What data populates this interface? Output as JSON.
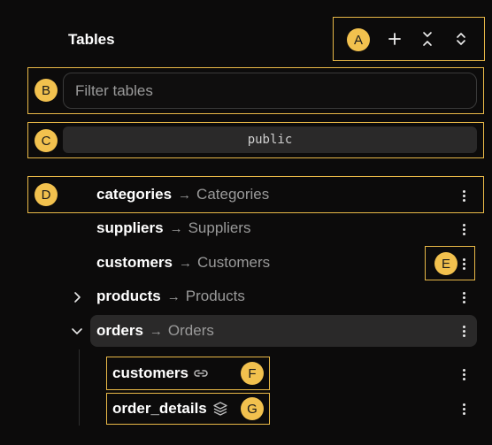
{
  "header": {
    "title": "Tables"
  },
  "search": {
    "placeholder": "Filter tables",
    "value": ""
  },
  "schema": {
    "selected": "public"
  },
  "tables": [
    {
      "name": "categories",
      "alias": "Categories"
    },
    {
      "name": "suppliers",
      "alias": "Suppliers"
    },
    {
      "name": "customers",
      "alias": "Customers"
    },
    {
      "name": "products",
      "alias": "Products",
      "expandable": true,
      "expanded": false
    },
    {
      "name": "orders",
      "alias": "Orders",
      "expandable": true,
      "expanded": true,
      "selected": true
    }
  ],
  "children": [
    {
      "name": "customers",
      "icon": "link-icon"
    },
    {
      "name": "order_details",
      "icon": "layers-icon"
    }
  ],
  "arrow_glyph": "→",
  "callouts": {
    "a": "A",
    "b": "B",
    "c": "C",
    "d": "D",
    "e": "E",
    "f": "F",
    "g": "G"
  },
  "colors": {
    "background": "#0c0b0b",
    "callout": "#f2c14e",
    "highlight": "#e8b847",
    "selected_row": "#2a2929"
  }
}
